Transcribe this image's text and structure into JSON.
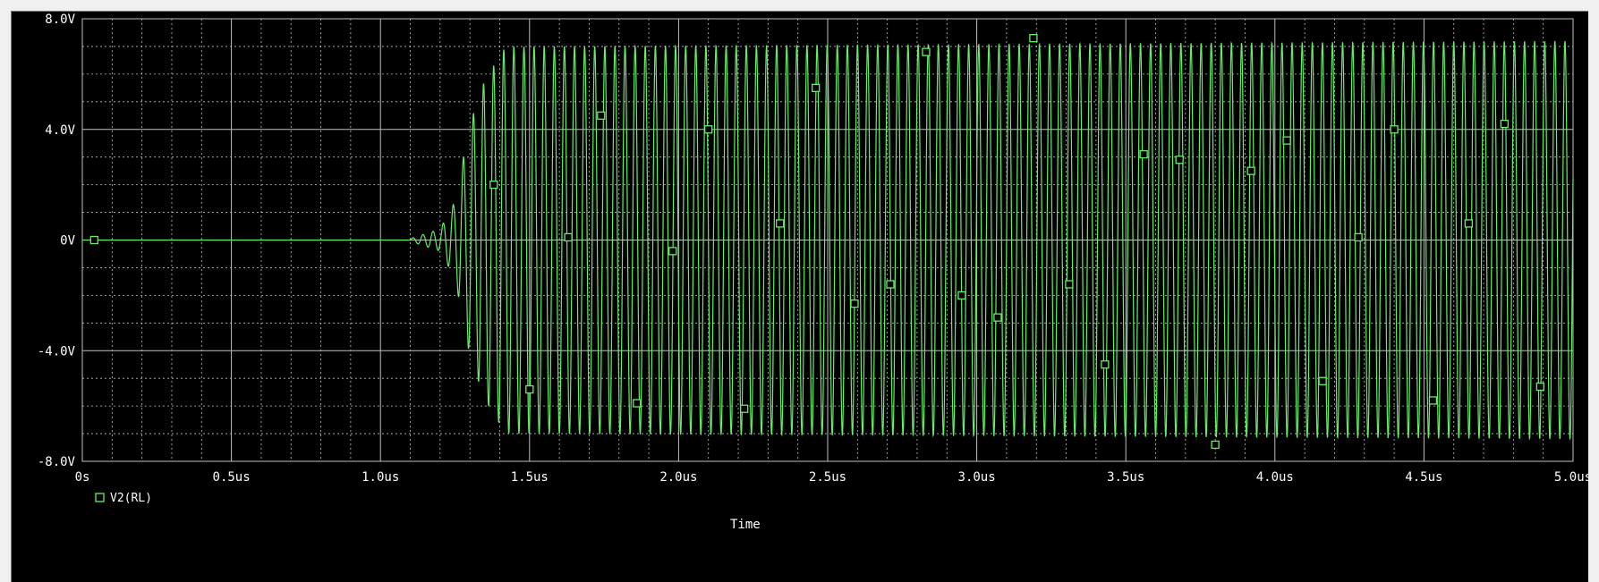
{
  "chart_data": {
    "type": "line",
    "title": "",
    "xlabel": "Time",
    "ylabel": "",
    "xlim": [
      0,
      5.0
    ],
    "ylim": [
      -8,
      8
    ],
    "x_ticks": [
      {
        "value": 0,
        "label": "0s"
      },
      {
        "value": 0.5,
        "label": "0.5us"
      },
      {
        "value": 1.0,
        "label": "1.0us"
      },
      {
        "value": 1.5,
        "label": "1.5us"
      },
      {
        "value": 2.0,
        "label": "2.0us"
      },
      {
        "value": 2.5,
        "label": "2.5us"
      },
      {
        "value": 3.0,
        "label": "3.0us"
      },
      {
        "value": 3.5,
        "label": "3.5us"
      },
      {
        "value": 4.0,
        "label": "4.0us"
      },
      {
        "value": 4.5,
        "label": "4.5us"
      },
      {
        "value": 5.0,
        "label": "5.0us"
      }
    ],
    "y_ticks": [
      {
        "value": 8,
        "label": "8.0V"
      },
      {
        "value": 4,
        "label": "4.0V"
      },
      {
        "value": 0,
        "label": "0V"
      },
      {
        "value": -4,
        "label": "-4.0V"
      },
      {
        "value": -8,
        "label": "-8.0V"
      }
    ],
    "grid": true,
    "legend_position": "bottom-left",
    "colors": {
      "background": "#000000",
      "grid": "#bfbfbf",
      "trace": "#66ee66",
      "text": "#ffffff"
    },
    "series": [
      {
        "name": "V2(RL)",
        "color": "#66ee66",
        "marker": "open-square",
        "signal": {
          "frequency_MHz": 29.5,
          "envelope": [
            {
              "t": 0.0,
              "amp": 0.0
            },
            {
              "t": 1.1,
              "amp": 0.05
            },
            {
              "t": 1.2,
              "amp": 0.4
            },
            {
              "t": 1.25,
              "amp": 1.4
            },
            {
              "t": 1.3,
              "amp": 4.2
            },
            {
              "t": 1.35,
              "amp": 5.8
            },
            {
              "t": 1.42,
              "amp": 7.0
            },
            {
              "t": 5.0,
              "amp": 7.2
            }
          ]
        },
        "points": [
          {
            "x": 0.04,
            "y": 0.0
          },
          {
            "x": 1.38,
            "y": 2.0
          },
          {
            "x": 1.5,
            "y": -5.4
          },
          {
            "x": 1.63,
            "y": 0.1
          },
          {
            "x": 1.74,
            "y": 4.5
          },
          {
            "x": 1.86,
            "y": -5.9
          },
          {
            "x": 1.98,
            "y": -0.4
          },
          {
            "x": 2.1,
            "y": 4.0
          },
          {
            "x": 2.22,
            "y": -6.1
          },
          {
            "x": 2.34,
            "y": 0.6
          },
          {
            "x": 2.46,
            "y": 5.5
          },
          {
            "x": 2.59,
            "y": -2.3
          },
          {
            "x": 2.71,
            "y": -1.6
          },
          {
            "x": 2.83,
            "y": 6.8
          },
          {
            "x": 2.95,
            "y": -2.0
          },
          {
            "x": 3.07,
            "y": -2.8
          },
          {
            "x": 3.19,
            "y": 7.3
          },
          {
            "x": 3.31,
            "y": -1.6
          },
          {
            "x": 3.43,
            "y": -4.5
          },
          {
            "x": 3.56,
            "y": 3.1
          },
          {
            "x": 3.68,
            "y": 2.9
          },
          {
            "x": 3.8,
            "y": -7.4
          },
          {
            "x": 3.92,
            "y": 2.5
          },
          {
            "x": 4.04,
            "y": 3.6
          },
          {
            "x": 4.16,
            "y": -5.1
          },
          {
            "x": 4.28,
            "y": 0.1
          },
          {
            "x": 4.4,
            "y": 4.0
          },
          {
            "x": 4.53,
            "y": -5.8
          },
          {
            "x": 4.65,
            "y": 0.6
          },
          {
            "x": 4.77,
            "y": 4.2
          },
          {
            "x": 4.89,
            "y": -5.3
          }
        ]
      }
    ]
  }
}
